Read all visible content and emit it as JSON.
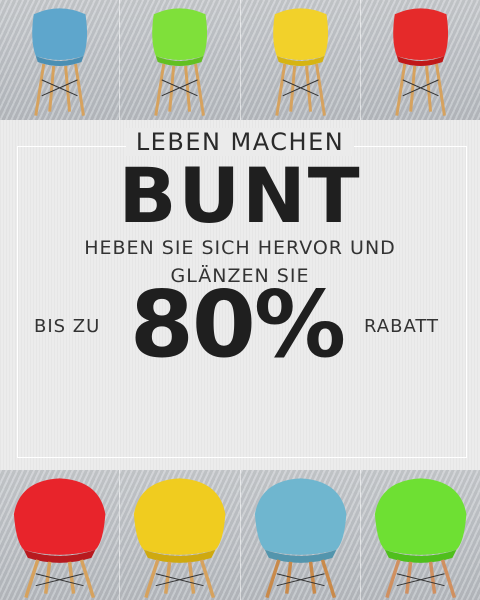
{
  "banner": {
    "line1": "LEBEN MACHEN",
    "headline": "BUNT",
    "subline_1": "HEBEN SIE SICH HERVOR UND",
    "subline_2": "GLÄNZEN SIE",
    "prefix": "BIS ZU",
    "percent": "80%",
    "suffix": "RABATT"
  },
  "top_chairs": [
    {
      "color": "#5ea6cc"
    },
    {
      "color": "#7fe03a"
    },
    {
      "color": "#f2d12a"
    },
    {
      "color": "#e52a2a"
    }
  ],
  "bottom_chairs": [
    {
      "color": "#e8242b"
    },
    {
      "color": "#f0cc1f"
    },
    {
      "color": "#6fb6cf"
    },
    {
      "color": "#6ee033"
    }
  ]
}
